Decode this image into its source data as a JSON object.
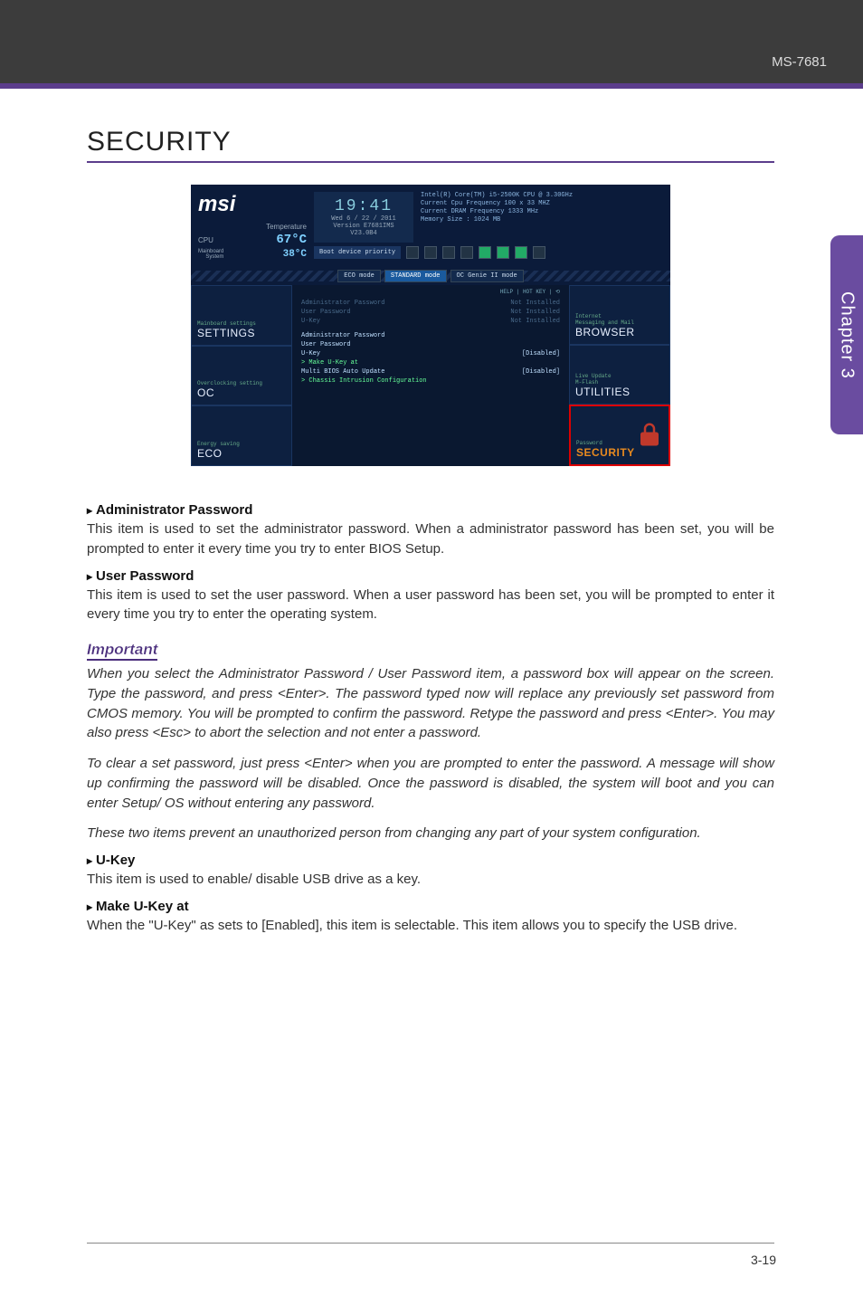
{
  "header": {
    "model": "MS-7681"
  },
  "sidetab": {
    "label": "Chapter 3"
  },
  "title": "SECURITY",
  "bios": {
    "logo": "msi",
    "temp_label": "Temperature",
    "cpu_label": "CPU",
    "cpu_temp": "67",
    "cpu_unit": "°C",
    "sys_label": "Mainboard\nSystem",
    "sys_temp": "38°C",
    "clock": "19:41",
    "date": "Wed  6 / 22 / 2011",
    "version": "Version E7681IMS V23.0B4",
    "info_line1": "Intel(R) Core(TM) i5-2500K CPU @ 3.30GHz",
    "info_line2": "Current Cpu Frequency 100 x 33 MHZ",
    "info_line3": "Current DRAM Frequency 1333 MHz",
    "info_line4": "Memory Size : 1024 MB",
    "boot_label": "Boot device priority",
    "mode_eco": "ECO mode",
    "mode_std": "STANDARD mode",
    "mode_genie": "OC Genie II mode",
    "help_bar": "HELP | HOT KEY | ⟲",
    "lines": [
      {
        "l": "Administrator Password",
        "r": "Not Installed",
        "dim": true
      },
      {
        "l": "User Password",
        "r": "Not Installed",
        "dim": true
      },
      {
        "l": "U-Key",
        "r": "Not Installed",
        "dim": true
      }
    ],
    "menu": [
      {
        "l": "Administrator Password",
        "r": ""
      },
      {
        "l": "User Password",
        "r": ""
      },
      {
        "l": "U-Key",
        "r": "[Disabled]"
      },
      {
        "l": "> Make U-Key at",
        "r": "",
        "arrow": true
      },
      {
        "l": "Multi BIOS Auto Update",
        "r": "[Disabled]"
      },
      {
        "l": "> Chassis Intrusion Configuration",
        "r": "",
        "arrow": true
      }
    ],
    "left_tiles": [
      {
        "sub": "Mainboard settings",
        "title": "SETTINGS"
      },
      {
        "sub": "Overclocking setting",
        "title": "OC"
      },
      {
        "sub": "Energy saving",
        "title": "ECO"
      }
    ],
    "right_tiles": [
      {
        "sub": "Internet\nMessaging and Mail",
        "title": "BROWSER"
      },
      {
        "sub": "Live Update\nM-Flash",
        "title": "UTILITIES"
      },
      {
        "sub": "Password",
        "title": "SECURITY"
      }
    ]
  },
  "items": {
    "admin_head": "Administrator Password",
    "admin_body": "This item is used to set the administrator password. When a administrator password has been set, you will be prompted to enter it every time you try to enter BIOS Setup.",
    "user_head": "User Password",
    "user_body": "This item is used to set the user password. When a user password has been set, you will be prompted to enter it every time you try to enter the operating system.",
    "important_label": "Important",
    "imp_p1": "When you select the Administrator Password / User Password item, a password box will appear on the screen. Type the password, and press <Enter>. The password typed now will replace any previously set password from CMOS memory. You will be prompted to confirm the password. Retype the password and press <Enter>. You may also press <Esc> to abort the selection and not enter a password.",
    "imp_p2": "To clear a set password, just press <Enter> when you are prompted to enter the password. A message will show up confirming the password will be disabled. Once the password is disabled, the system will boot and you can enter Setup/ OS without entering any password.",
    "imp_p3": "These two items prevent an unauthorized person from changing any part of your system configuration.",
    "ukey_head": "U-Key",
    "ukey_body": "This item is used to enable/ disable USB drive as a key.",
    "make_head": "Make U-Key at",
    "make_body": "When the \"U-Key\" as sets to [Enabled], this item is selectable. This item allows you to specify the USB drive."
  },
  "footer": {
    "page": "3-19"
  }
}
